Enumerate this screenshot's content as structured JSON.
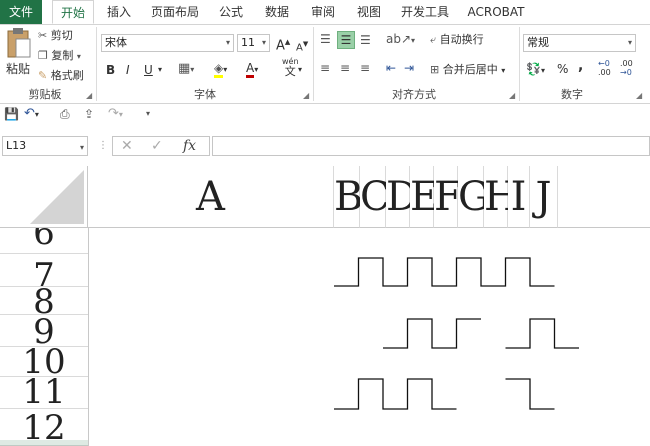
{
  "tabs": [
    "文件",
    "开始",
    "插入",
    "页面布局",
    "公式",
    "数据",
    "审阅",
    "视图",
    "开发工具",
    "ACROBAT"
  ],
  "clipboard": {
    "paste_label": "粘贴",
    "cut_label": "剪切",
    "copy_label": "复制",
    "format_painter_label": "格式刷",
    "group_label": "剪贴板"
  },
  "font": {
    "name": "宋体",
    "size": "11",
    "bold": "B",
    "italic": "I",
    "underline": "U",
    "group_label": "字体",
    "increase": "A",
    "decrease": "A",
    "font_color": "A",
    "wen": "wén",
    "wen_char": "文"
  },
  "alignment": {
    "wrap_label": "自动换行",
    "merge_label": "合并后居中",
    "group_label": "对齐方式"
  },
  "number": {
    "format": "常规",
    "percent": "%",
    "comma": ",",
    "group_label": "数字",
    "dec_inc": ".00",
    "dec_dec": ".00"
  },
  "formula_bar": {
    "name_box": "L13",
    "fx": "fx",
    "cancel": "✕",
    "enter": "✓",
    "formula": ""
  },
  "columns": [
    "A",
    "B",
    "C",
    "D",
    "E",
    "F",
    "G",
    "H",
    "I",
    "J"
  ],
  "rows": [
    "6",
    "7",
    "8",
    "9",
    "10",
    "11",
    "12"
  ],
  "waveform": {
    "rows": [
      [
        0,
        1,
        0,
        1,
        0,
        1,
        0,
        1,
        0
      ],
      [
        null,
        null,
        0,
        1,
        0,
        1,
        null,
        0,
        1,
        0
      ],
      [
        0,
        1,
        0,
        1,
        0,
        null,
        null,
        1,
        0
      ]
    ]
  }
}
